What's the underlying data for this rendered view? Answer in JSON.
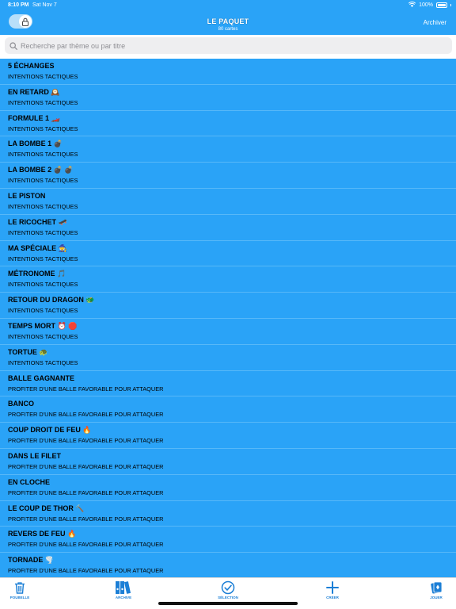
{
  "status_bar": {
    "time": "8:10 PM",
    "date": "Sat Nov 7",
    "battery": "100%"
  },
  "header": {
    "title": "LE PAQUET",
    "subtitle": "80 cartes",
    "archive_label": "Archiver"
  },
  "search": {
    "placeholder": "Recherche par thème ou par titre",
    "value": ""
  },
  "cards": [
    {
      "title": "5 ÉCHANGES",
      "category": "INTENTIONS TACTIQUES"
    },
    {
      "title": "EN RETARD 🕰️",
      "category": "INTENTIONS TACTIQUES"
    },
    {
      "title": "FORMULE 1 🏎️",
      "category": "INTENTIONS TACTIQUES"
    },
    {
      "title": "LA BOMBE 1 💣",
      "category": "INTENTIONS TACTIQUES"
    },
    {
      "title": "LA BOMBE 2 💣 💣",
      "category": "INTENTIONS TACTIQUES"
    },
    {
      "title": "LE PISTON",
      "category": "INTENTIONS TACTIQUES"
    },
    {
      "title": "LE RICOCHET 🛹",
      "category": "INTENTIONS TACTIQUES"
    },
    {
      "title": "MA SPÉCIALE 🧙",
      "category": "INTENTIONS TACTIQUES"
    },
    {
      "title": "MÉTRONOME 🎵",
      "category": "INTENTIONS TACTIQUES"
    },
    {
      "title": "RETOUR DU DRAGON 🐲",
      "category": "INTENTIONS TACTIQUES"
    },
    {
      "title": "TEMPS MORT ⏰ 🛑",
      "category": "INTENTIONS TACTIQUES"
    },
    {
      "title": "TORTUE 🐢",
      "category": "INTENTIONS TACTIQUES"
    },
    {
      "title": "BALLE GAGNANTE",
      "category": "PROFITER D'UNE BALLE FAVORABLE POUR ATTAQUER"
    },
    {
      "title": "BANCO",
      "category": "PROFITER D'UNE BALLE FAVORABLE POUR ATTAQUER"
    },
    {
      "title": "COUP DROIT DE FEU 🔥",
      "category": "PROFITER D'UNE BALLE FAVORABLE POUR ATTAQUER"
    },
    {
      "title": "DANS LE FILET",
      "category": "PROFITER D'UNE BALLE FAVORABLE POUR ATTAQUER"
    },
    {
      "title": "EN CLOCHE",
      "category": "PROFITER D'UNE BALLE FAVORABLE POUR ATTAQUER"
    },
    {
      "title": "LE COUP DE THOR 🔨",
      "category": "PROFITER D'UNE BALLE FAVORABLE POUR ATTAQUER"
    },
    {
      "title": "REVERS DE FEU 🔥",
      "category": "PROFITER D'UNE BALLE FAVORABLE POUR ATTAQUER"
    },
    {
      "title": "TORNADE 🌪️",
      "category": "PROFITER D'UNE BALLE FAVORABLE POUR ATTAQUER"
    }
  ],
  "tabs": [
    {
      "label": "POUBELLE",
      "icon": "trash-icon"
    },
    {
      "label": "ARCHIVE",
      "icon": "binders-icon"
    },
    {
      "label": "SÉLECTION",
      "icon": "checkmark-circle-icon"
    },
    {
      "label": "CRÉER",
      "icon": "plus-icon"
    },
    {
      "label": "JOUER",
      "icon": "cards-icon"
    }
  ],
  "colors": {
    "accent": "#2aa3f7",
    "tab_tint": "#1c7fd6"
  }
}
